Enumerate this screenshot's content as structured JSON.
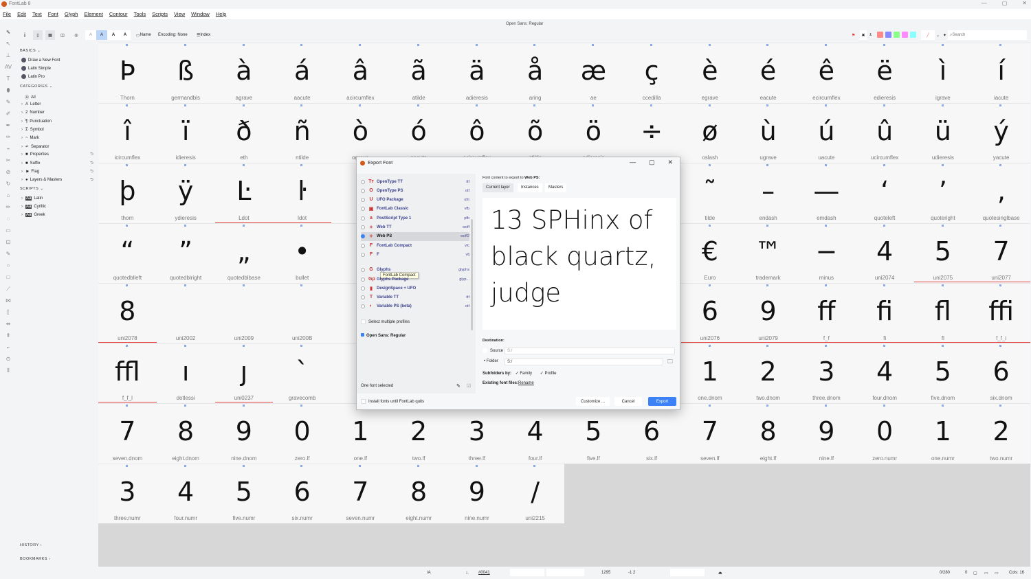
{
  "app": {
    "title": "FontLab 8",
    "document_title": "Open Sans: Regular"
  },
  "menu": [
    "File",
    "Edit",
    "Text",
    "Font",
    "Glyph",
    "Element",
    "Contour",
    "Tools",
    "Scripts",
    "View",
    "Window",
    "Help"
  ],
  "toolbar": {
    "name_label": "Name",
    "encoding_label": "Encoding: None",
    "index_label": "Index",
    "search_placeholder": "Search",
    "size_letters": [
      "A",
      "A",
      "A",
      "A"
    ],
    "swatches": [
      "#ff8a8a",
      "#8a8aff",
      "#8aff8a",
      "#ff8aff",
      "#8affff"
    ]
  },
  "sidebar": {
    "basics_label": "BASICS",
    "basics": [
      "Draw a New Font",
      "Latin Simple",
      "Latin Pro"
    ],
    "categories_label": "CATEGORIES",
    "categories": [
      "All",
      "Letter",
      "Number",
      "Punctuation",
      "Symbol",
      "Mark",
      "Separator",
      "Properties",
      "Suffix",
      "Flag",
      "Layers & Masters"
    ],
    "category_icons": [
      "Ⓐ",
      "A",
      "2",
      "¶",
      "Σ",
      "~",
      "↵",
      "■",
      "■",
      "⚑",
      "●"
    ],
    "scripts_label": "SCRIPTS",
    "scripts": [
      "Latin",
      "Cyrillic",
      "Greek"
    ],
    "history_label": "HISTORY",
    "bookmarks_label": "BOOKMARKS"
  },
  "glyphs": [
    [
      "Þ",
      "Thorn"
    ],
    [
      "ß",
      "germandbls"
    ],
    [
      "à",
      "agrave"
    ],
    [
      "á",
      "aacute"
    ],
    [
      "â",
      "acircumflex"
    ],
    [
      "ã",
      "atilde"
    ],
    [
      "ä",
      "adieresis"
    ],
    [
      "å",
      "aring"
    ],
    [
      "æ",
      "ae"
    ],
    [
      "ç",
      "ccedilla"
    ],
    [
      "è",
      "egrave"
    ],
    [
      "é",
      "eacute"
    ],
    [
      "ê",
      "ecircumflex"
    ],
    [
      "ë",
      "edieresis"
    ],
    [
      "ì",
      "igrave"
    ],
    [
      "í",
      "iacute"
    ],
    [
      "î",
      "icircumflex"
    ],
    [
      "ï",
      "idieresis"
    ],
    [
      "ð",
      "eth"
    ],
    [
      "ñ",
      "ntilde"
    ],
    [
      "ò",
      "ograve"
    ],
    [
      "ó",
      "oacute"
    ],
    [
      "ô",
      "ocircumflex"
    ],
    [
      "õ",
      "otilde"
    ],
    [
      "ö",
      "odieresis"
    ],
    [
      "÷",
      ""
    ],
    [
      "ø",
      "oslash"
    ],
    [
      "ù",
      "ugrave"
    ],
    [
      "ú",
      "uacute"
    ],
    [
      "û",
      "ucircumflex"
    ],
    [
      "ü",
      "udieresis"
    ],
    [
      "ý",
      "yacute"
    ],
    [
      "þ",
      "thorn"
    ],
    [
      "ÿ",
      "ydieresis"
    ],
    [
      "Ŀ",
      "Ldot",
      1
    ],
    [
      "ŀ",
      "ldot",
      1
    ],
    [
      "",
      ""
    ],
    [
      "",
      ""
    ],
    [
      "",
      ""
    ],
    [
      "",
      ""
    ],
    [
      "",
      ""
    ],
    [
      "",
      ""
    ],
    [
      "˜",
      "tilde"
    ],
    [
      "–",
      "endash"
    ],
    [
      "—",
      "emdash"
    ],
    [
      "‘",
      "quoteleft"
    ],
    [
      "’",
      "quoteright"
    ],
    [
      "‚",
      "quotesinglbase"
    ],
    [
      "“",
      "quotedblleft"
    ],
    [
      "”",
      "quotedblright"
    ],
    [
      "„",
      "quotedblbase"
    ],
    [
      "•",
      "bullet"
    ],
    [
      "",
      ""
    ],
    [
      "",
      ""
    ],
    [
      "",
      ""
    ],
    [
      "",
      ""
    ],
    [
      "",
      ""
    ],
    [
      "",
      ""
    ],
    [
      "€",
      "Euro"
    ],
    [
      "™",
      "trademark"
    ],
    [
      "−",
      "minus"
    ],
    [
      "4",
      "uni2074"
    ],
    [
      "5",
      "uni2075",
      1
    ],
    [
      "7",
      "uni2077",
      1
    ],
    [
      "8",
      "uni2078",
      1
    ],
    [
      "",
      "uni2002"
    ],
    [
      "",
      "uni2009"
    ],
    [
      "",
      "uni200B"
    ],
    [
      "",
      ""
    ],
    [
      "",
      ""
    ],
    [
      "",
      ""
    ],
    [
      "",
      ""
    ],
    [
      "",
      ""
    ],
    [
      "",
      ""
    ],
    [
      "6",
      "uni2076",
      1
    ],
    [
      "9",
      "uni2079",
      1
    ],
    [
      "ff",
      "f_f",
      1
    ],
    [
      "fi",
      "fi",
      1
    ],
    [
      "fl",
      "fl",
      1
    ],
    [
      "ffi",
      "f_f_i",
      1
    ],
    [
      "ffl",
      "f_f_l",
      1
    ],
    [
      "ı",
      "dotlessi"
    ],
    [
      "ȷ",
      "uni0237",
      1
    ],
    [
      "`",
      "gravecomb"
    ],
    [
      "",
      ""
    ],
    [
      "",
      ""
    ],
    [
      "",
      ""
    ],
    [
      "",
      ""
    ],
    [
      "",
      ""
    ],
    [
      "",
      ""
    ],
    [
      "1",
      "one.dnom"
    ],
    [
      "2",
      "two.dnom"
    ],
    [
      "3",
      "three.dnom"
    ],
    [
      "4",
      "four.dnom"
    ],
    [
      "5",
      "five.dnom"
    ],
    [
      "6",
      "six.dnom"
    ],
    [
      "7",
      "seven.dnom"
    ],
    [
      "8",
      "eight.dnom"
    ],
    [
      "9",
      "nine.dnom"
    ],
    [
      "0",
      "zero.lf"
    ],
    [
      "1",
      "one.lf"
    ],
    [
      "2",
      "two.lf"
    ],
    [
      "3",
      "three.lf"
    ],
    [
      "4",
      "four.lf"
    ],
    [
      "5",
      "five.lf"
    ],
    [
      "6",
      "six.lf"
    ],
    [
      "7",
      "seven.lf"
    ],
    [
      "8",
      "eight.lf"
    ],
    [
      "9",
      "nine.lf"
    ],
    [
      "0",
      "zero.numr"
    ],
    [
      "1",
      "one.numr"
    ],
    [
      "2",
      "two.numr"
    ],
    [
      "3",
      "three.numr"
    ],
    [
      "4",
      "four.numr"
    ],
    [
      "5",
      "five.numr"
    ],
    [
      "6",
      "six.numr"
    ],
    [
      "7",
      "seven.numr"
    ],
    [
      "8",
      "eight.numr"
    ],
    [
      "9",
      "nine.numr"
    ],
    [
      "∕",
      "uni2215"
    ]
  ],
  "dialog": {
    "title": "Export Font",
    "profiles": [
      {
        "icon": "Tт",
        "label": "OpenType TT",
        "ext": "ttf"
      },
      {
        "icon": "O",
        "label": "OpenType PS",
        "ext": "otf"
      },
      {
        "icon": "U",
        "label": "UFO Package",
        "ext": "ufo"
      },
      {
        "icon": "▣",
        "label": "FontLab Classic",
        "ext": "vfb"
      },
      {
        "icon": "a",
        "label": "PostScript Type 1",
        "ext": "pfb"
      },
      {
        "icon": "✧",
        "label": "Web TT",
        "ext": "woff"
      },
      {
        "icon": "✧",
        "label": "Web PS",
        "ext": "woff2",
        "selected": true
      },
      {
        "icon": "F",
        "label": "FontLab Compact",
        "ext": "vfc"
      },
      {
        "icon": "F",
        "label": "F",
        "ext": "vfj"
      },
      {
        "icon": "G",
        "label": "Glyphs",
        "ext": "glyphs"
      },
      {
        "icon": "Gp",
        "label": "Glyphs Package",
        "ext": "glyp..."
      },
      {
        "icon": "▮",
        "label": "DesignSpace + UFO",
        "ext": ""
      },
      {
        "icon": "T",
        "label": "Variable TT",
        "ext": "ttf"
      },
      {
        "icon": "◐",
        "label": "Variable PS (beta)",
        "ext": "otf"
      }
    ],
    "tooltip": "FontLab Compact",
    "select_multiple": "Select multiple profiles",
    "font_name": "Open Sans: Regular",
    "fonts_selected": "One font selected",
    "install_fonts": "Install fonts until FontLab quits",
    "content_label": "Font content to export to",
    "content_target": "Web PS:",
    "tabs": [
      "Current layer",
      "Instances",
      "Masters"
    ],
    "preview": [
      "13 SPHinx of",
      "black quartz,",
      "judge"
    ],
    "destination_label": "Destination:",
    "source_label": "Source",
    "source_value": "S:/",
    "folder_label": "Folder",
    "folder_value": "S:/",
    "subfolders_label": "Subfolders by:",
    "family_label": "Family",
    "profile_label": "Profile",
    "existing_label": "Existing font files:",
    "existing_value": "Rename",
    "customize": "Customize ...",
    "cancel": "Cancel",
    "export": "Export",
    "accent": "#3b82f6"
  },
  "status": {
    "glyph": "/A",
    "unicode": "#0041",
    "size": "1295",
    "step": "-1 2",
    "count": "0/280",
    "zero": "0",
    "cols": "Cols: 16"
  }
}
